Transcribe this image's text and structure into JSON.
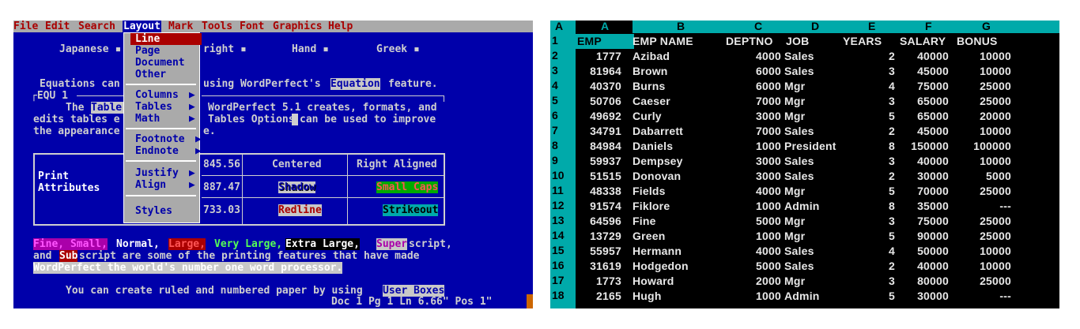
{
  "wp": {
    "menu": [
      "File",
      "Edit",
      "Search",
      "Layout",
      "Mark",
      "Tools",
      "Font",
      "Graphics",
      "Help"
    ],
    "layout_menu": {
      "group1": [
        "Line",
        "Page",
        "Document",
        "Other"
      ],
      "group2": [
        "Columns",
        "Tables",
        "Math"
      ],
      "group3": [
        "Footnote",
        "Endnote"
      ],
      "group4": [
        "Justify",
        "Align"
      ],
      "group5": [
        "Styles"
      ]
    },
    "tab_row": {
      "japanese": "Japanese",
      "right": "right",
      "hand": "Hand",
      "greek": "Greek"
    },
    "equations": {
      "pre": "Equations can",
      "post": "using WordPerfect's",
      "highlight": "Equation",
      "tail": "feature."
    },
    "equ_label": "EQU 1",
    "para": {
      "l1a": "The",
      "l1b": "Table",
      "l1c": "WordPerfect 5.1 creates, formats, and",
      "l2a": "edits tables e",
      "l2b": "Tables Options",
      "l2c": "can be used to improve",
      "l3a": "the appearance",
      "l3b": "e."
    },
    "table": {
      "num1": "845.56",
      "num2": "887.47",
      "num3": "733.03",
      "centered": "Centered",
      "right_aligned": "Right Aligned",
      "print": "Print",
      "attributes": "Attributes",
      "shadow": "Shadow",
      "small_caps": "Small Caps",
      "redline": "Redline",
      "strikeout": "Strikeout"
    },
    "sizes": {
      "fine_small": "Fine, Small,",
      "normal": "Normal,",
      "large": "Large,",
      "very_large": "Very Large,",
      "extra_large": "Extra Large,",
      "super": "Super",
      "script": "script,",
      "and": "and",
      "sub": "Sub",
      "line2": "script are some of the printing features that have made",
      "line3": "WordPerfect the world's number one word processor."
    },
    "ruled": {
      "text": "You can create ruled and numbered paper by using",
      "highlight": "User Boxes"
    },
    "status": "Doc 1 Pg 1 Ln 6.66\" Pos 1\""
  },
  "ss": {
    "corner": "A",
    "columns": [
      "A",
      "B",
      "C",
      "D",
      "E",
      "F",
      "G"
    ],
    "headers": [
      "EMP",
      "EMP NAME",
      "DEPTNO",
      "JOB",
      "YEARS",
      "SALARY",
      "BONUS"
    ],
    "rownums": [
      "1",
      "2",
      "3",
      "4",
      "5",
      "6",
      "7",
      "8",
      "9",
      "10",
      "11",
      "12",
      "13",
      "14",
      "15",
      "16",
      "17",
      "18"
    ],
    "rows": [
      [
        "1777",
        "Azibad",
        "4000",
        "Sales",
        "2",
        "40000",
        "10000"
      ],
      [
        "81964",
        "Brown",
        "6000",
        "Sales",
        "3",
        "45000",
        "10000"
      ],
      [
        "40370",
        "Burns",
        "6000",
        "Mgr",
        "4",
        "75000",
        "25000"
      ],
      [
        "50706",
        "Caeser",
        "7000",
        "Mgr",
        "3",
        "65000",
        "25000"
      ],
      [
        "49692",
        "Curly",
        "3000",
        "Mgr",
        "5",
        "65000",
        "20000"
      ],
      [
        "34791",
        "Dabarrett",
        "7000",
        "Sales",
        "2",
        "45000",
        "10000"
      ],
      [
        "84984",
        "Daniels",
        "1000",
        "President",
        "8",
        "150000",
        "100000"
      ],
      [
        "59937",
        "Dempsey",
        "3000",
        "Sales",
        "3",
        "40000",
        "10000"
      ],
      [
        "51515",
        "Donovan",
        "3000",
        "Sales",
        "2",
        "30000",
        "5000"
      ],
      [
        "48338",
        "Fields",
        "4000",
        "Mgr",
        "5",
        "70000",
        "25000"
      ],
      [
        "91574",
        "Fiklore",
        "1000",
        "Admin",
        "8",
        "35000",
        "---"
      ],
      [
        "64596",
        "Fine",
        "5000",
        "Mgr",
        "3",
        "75000",
        "25000"
      ],
      [
        "13729",
        "Green",
        "1000",
        "Mgr",
        "5",
        "90000",
        "25000"
      ],
      [
        "55957",
        "Hermann",
        "4000",
        "Sales",
        "4",
        "50000",
        "10000"
      ],
      [
        "31619",
        "Hodgedon",
        "5000",
        "Sales",
        "2",
        "40000",
        "10000"
      ],
      [
        "1773",
        "Howard",
        "2000",
        "Mgr",
        "3",
        "80000",
        "25000"
      ],
      [
        "2165",
        "Hugh",
        "1000",
        "Admin",
        "5",
        "30000",
        "---"
      ]
    ]
  }
}
